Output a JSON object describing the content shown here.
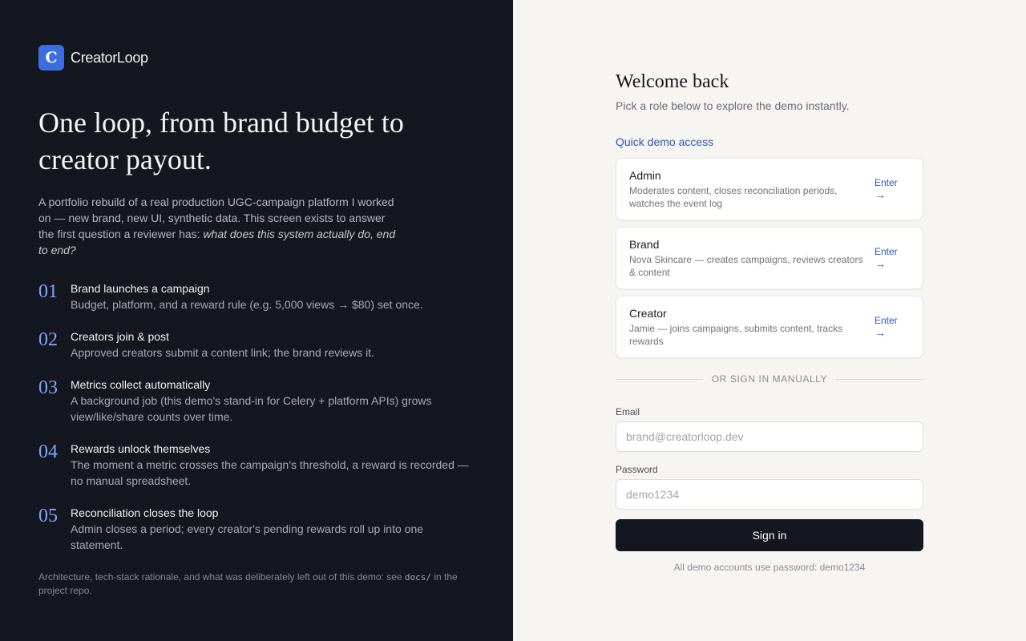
{
  "brand": {
    "logo_letter": "C",
    "name": "CreatorLoop",
    "accent": "#3d6ee0"
  },
  "hero": {
    "headline": "One loop, from brand budget to creator payout.",
    "intro": "A portfolio rebuild of a real production UGC-campaign platform I worked on — new brand, new UI, synthetic data. This screen exists to answer the first question a reviewer has: ",
    "intro_em": "what does this system actually do, end to end?"
  },
  "steps": [
    {
      "num": "01",
      "title": "Brand launches a campaign",
      "desc": "Budget, platform, and a reward rule (e.g. 5,000 views → $80) set once."
    },
    {
      "num": "02",
      "title": "Creators join & post",
      "desc": "Approved creators submit a content link; the brand reviews it."
    },
    {
      "num": "03",
      "title": "Metrics collect automatically",
      "desc": "A background job (this demo's stand-in for Celery + platform APIs) grows view/like/share counts over time."
    },
    {
      "num": "04",
      "title": "Rewards unlock themselves",
      "desc": "The moment a metric crosses the campaign's threshold, a reward is recorded — no manual spreadsheet."
    },
    {
      "num": "05",
      "title": "Reconciliation closes the loop",
      "desc": "Admin closes a period; every creator's pending rewards roll up into one statement."
    }
  ],
  "footnote": {
    "before": "Architecture, tech-stack rationale, and what was deliberately left out of this demo: see ",
    "code": "docs/",
    "after": " in the project repo."
  },
  "login": {
    "title": "Welcome back",
    "subtitle": "Pick a role below to explore the demo instantly.",
    "quick_label": "Quick demo access",
    "roles": [
      {
        "title": "Admin",
        "desc": "Moderates content, closes reconciliation periods, watches the event log",
        "enter": "Enter",
        "arrow": "→"
      },
      {
        "title": "Brand",
        "desc": "Nova Skincare — creates campaigns, reviews creators & content",
        "enter": "Enter",
        "arrow": "→"
      },
      {
        "title": "Creator",
        "desc": "Jamie — joins campaigns, submits content, tracks rewards",
        "enter": "Enter",
        "arrow": "→"
      }
    ],
    "divider": "OR SIGN IN MANUALLY",
    "email_label": "Email",
    "email_placeholder": "brand@creatorloop.dev",
    "email_value": "",
    "password_label": "Password",
    "password_placeholder": "demo1234",
    "password_value": "",
    "signin_label": "Sign in",
    "hint": "All demo accounts use password: demo1234"
  }
}
